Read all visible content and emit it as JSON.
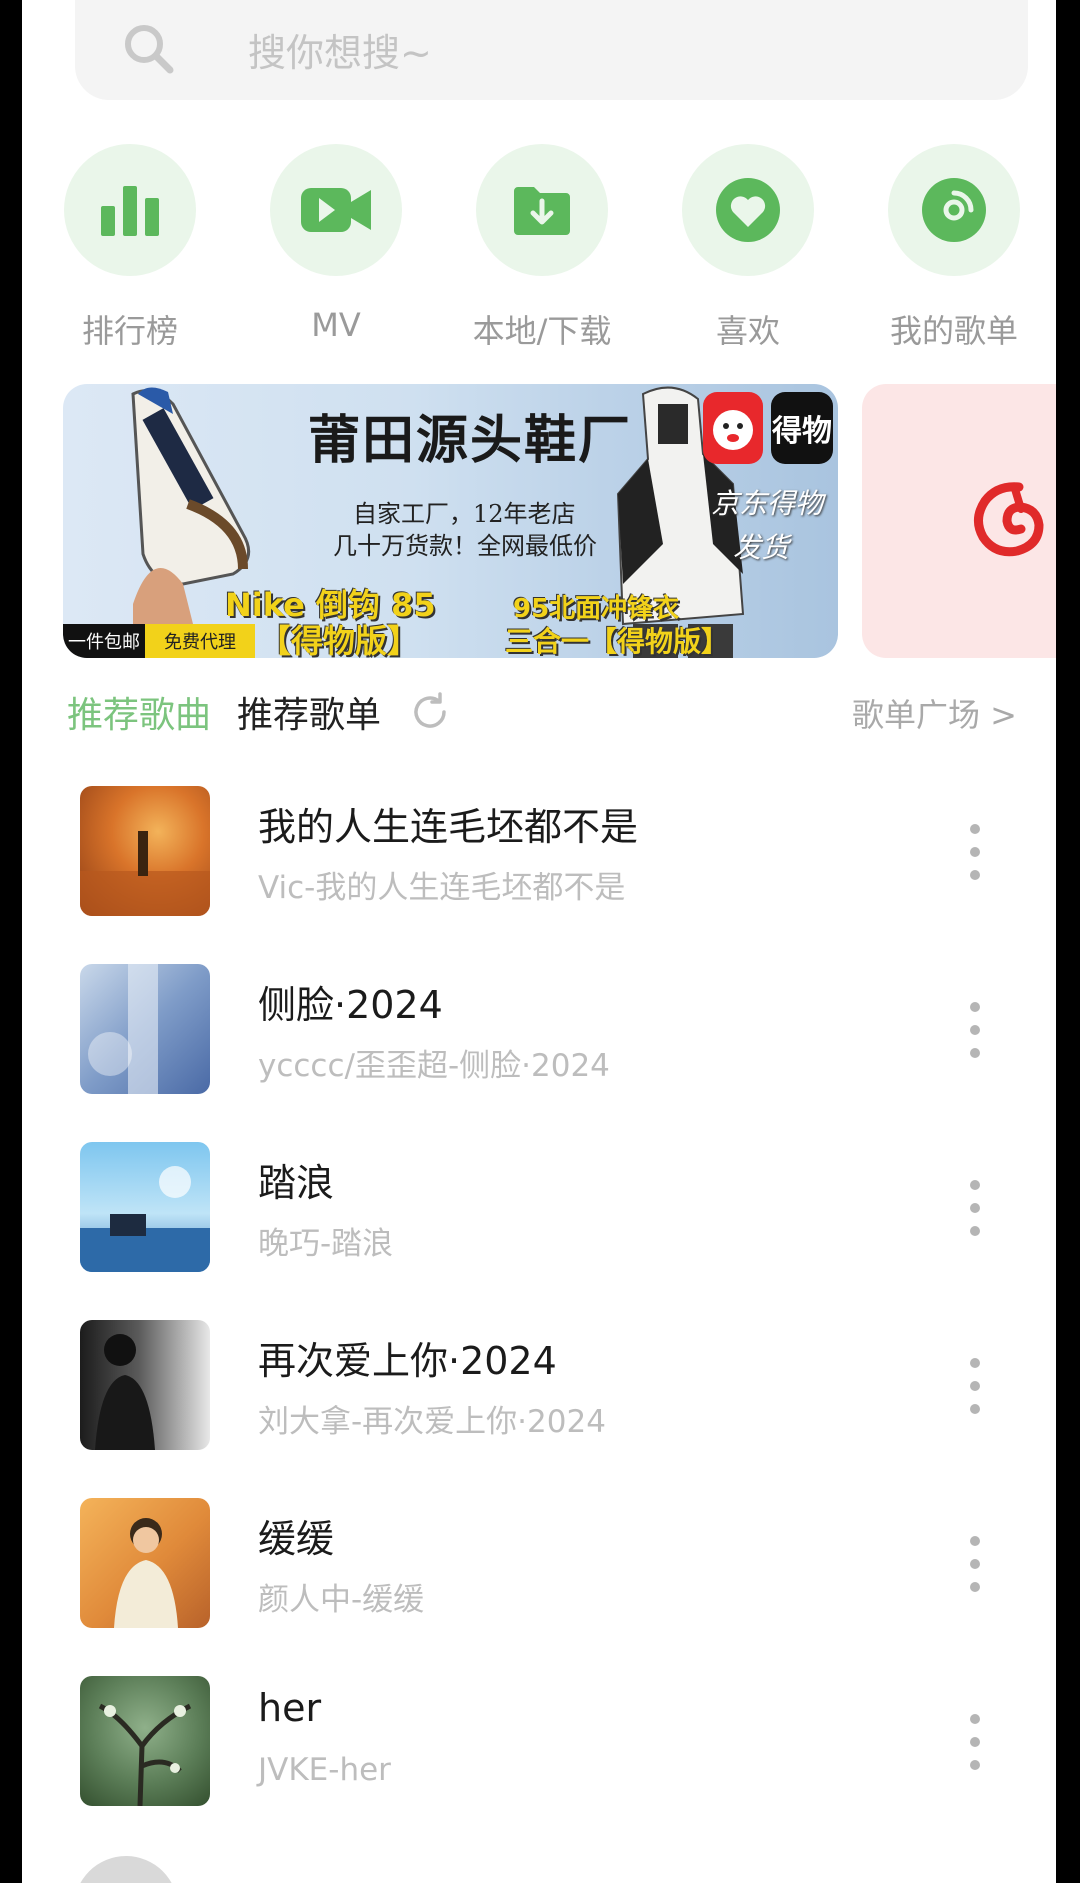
{
  "search": {
    "placeholder": "搜你想搜~",
    "icon": "search-icon"
  },
  "quick_actions": [
    {
      "label": "排行榜",
      "icon": "bar-chart-icon"
    },
    {
      "label": "MV",
      "icon": "video-camera-icon"
    },
    {
      "label": "本地/下载",
      "icon": "download-folder-icon"
    },
    {
      "label": "喜欢",
      "icon": "heart-icon"
    },
    {
      "label": "我的歌单",
      "icon": "playlist-disc-icon"
    }
  ],
  "banner": {
    "title": "莆田源头鞋厂",
    "line1": "自家工厂，12年老店",
    "line2": "几十万货款！全网最低价",
    "nike": "Nike 倒钩 85",
    "nike_sub": "【得物版】",
    "jacket": "95北面冲锋衣",
    "jacket_sub": "三合一【得物版】",
    "tag1": "一件包邮",
    "tag2": "免费代理",
    "jd_text": "京东得物",
    "ship_text": "发货",
    "app2_text": "得物"
  },
  "tabs": {
    "recommended_songs": "推荐歌曲",
    "recommended_playlists": "推荐歌单",
    "playlist_plaza": "歌单广场 >"
  },
  "songs": [
    {
      "title": "我的人生连毛坯都不是",
      "subtitle": "Vic-我的人生连毛坯都不是"
    },
    {
      "title": "侧脸·2024",
      "subtitle": "ycccc/歪歪超-侧脸·2024"
    },
    {
      "title": "踏浪",
      "subtitle": "晚巧-踏浪"
    },
    {
      "title": "再次爱上你·2024",
      "subtitle": "刘大拿-再次爱上你·2024"
    },
    {
      "title": "缓缓",
      "subtitle": "颜人中-缓缓"
    },
    {
      "title": "her",
      "subtitle": "JVKE-her"
    }
  ],
  "colors": {
    "accent": "#7cc47e",
    "icon_green": "#5cb85c",
    "icon_bg": "#eaf6ea",
    "muted": "#bdbdbd",
    "netease_red": "#e02a2a"
  }
}
